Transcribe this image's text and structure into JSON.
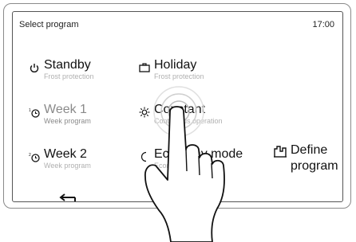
{
  "header": {
    "title": "Select program",
    "time": "17:00"
  },
  "programs": {
    "standby": {
      "label": "Standby",
      "sub": "Frost protection"
    },
    "holiday": {
      "label": "Holiday",
      "sub": "Frost protection"
    },
    "week1": {
      "label": "Week 1",
      "sub": "Week program"
    },
    "constant": {
      "label": "Constant",
      "sub": "Continuous operation"
    },
    "week2": {
      "label": "Week 2",
      "sub": "Week program"
    },
    "economy": {
      "label": "Economy mode",
      "sub": "Economy operation"
    }
  },
  "define": {
    "line1": "Define",
    "line2": "program"
  },
  "icons": {
    "standby": "power-icon",
    "holiday": "suitcase-icon",
    "week1": "week-clock-1-icon",
    "constant": "sun-icon",
    "week2": "week-clock-2-icon",
    "economy": "moon-icon",
    "define": "define-program-icon",
    "back": "back-arrow-icon"
  }
}
